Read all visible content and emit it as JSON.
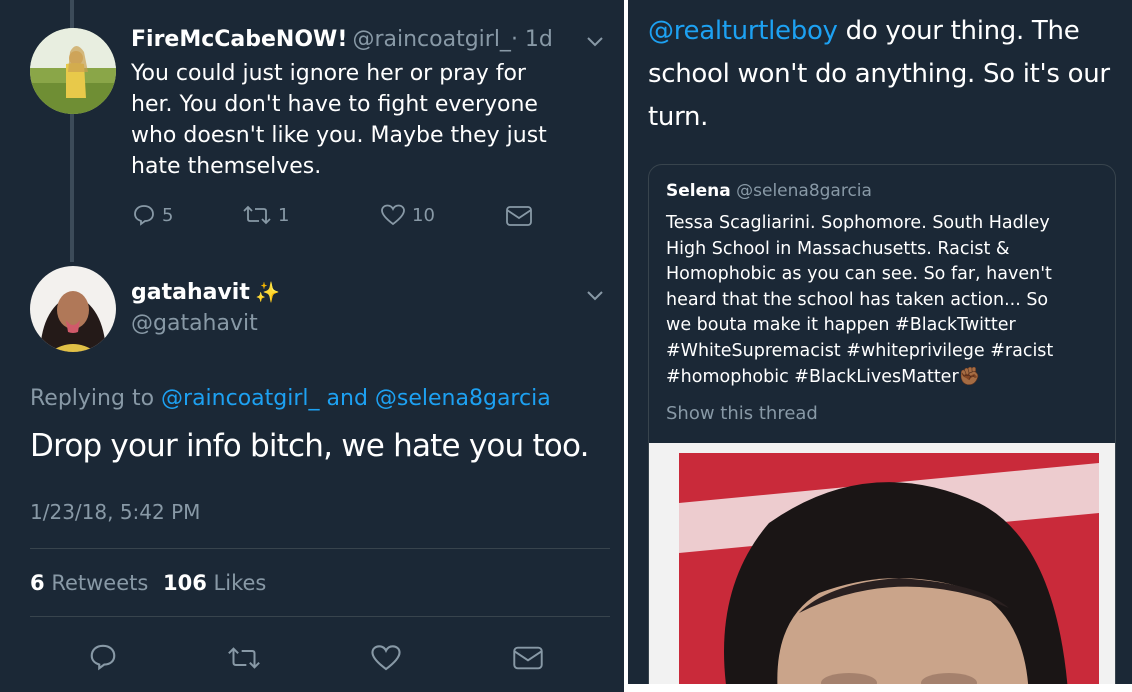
{
  "left_tweet_reply": {
    "name": "FireMcCabeNOW!",
    "handle": "@raincoatgirl_",
    "time": "· 1d",
    "text_lines": [
      "You could just ignore her or pray for",
      "her. You don't have to fight everyone",
      "who doesn't like you. Maybe they just",
      "hate themselves."
    ],
    "replies": "5",
    "retweets": "1",
    "likes": "10"
  },
  "left_tweet_main": {
    "name": "gatahavit",
    "emoji": "✨",
    "handle": "@gatahavit",
    "replying_prefix": "Replying to",
    "replying_user1": "@raincoatgirl_",
    "replying_and": "and",
    "replying_user2": "@selena8garcia",
    "text": "Drop your info bitch, we hate you too.",
    "timestamp": "1/23/18, 5:42 PM",
    "retweet_count": "6",
    "retweet_label": "Retweets",
    "like_count": "106",
    "like_label": "Likes"
  },
  "right_tweet": {
    "mention": "@realturtleboy",
    "text_line1_rest": " do your thing. The",
    "text_line2": "school won't do anything. So it's our",
    "text_line3": "turn.",
    "quote": {
      "name": "Selena",
      "handle": "@selena8garcia",
      "lines": [
        "Tessa Scagliarini. Sophomore. South Hadley",
        "High School in Massachusetts. Racist &",
        "Homophobic as you can see. So far, haven't",
        "heard that the school has taken action... So",
        "we bouta make it happen #BlackTwitter",
        "#WhiteSupremacist #whiteprivilege #racist",
        "#homophobic #BlackLivesMatter"
      ],
      "fist_emoji": "✊🏾",
      "show_thread": "Show this thread"
    }
  },
  "colors": {
    "background": "#1b2836",
    "muted": "#8899a6",
    "link": "#1da1f2",
    "divider": "#38444d"
  }
}
